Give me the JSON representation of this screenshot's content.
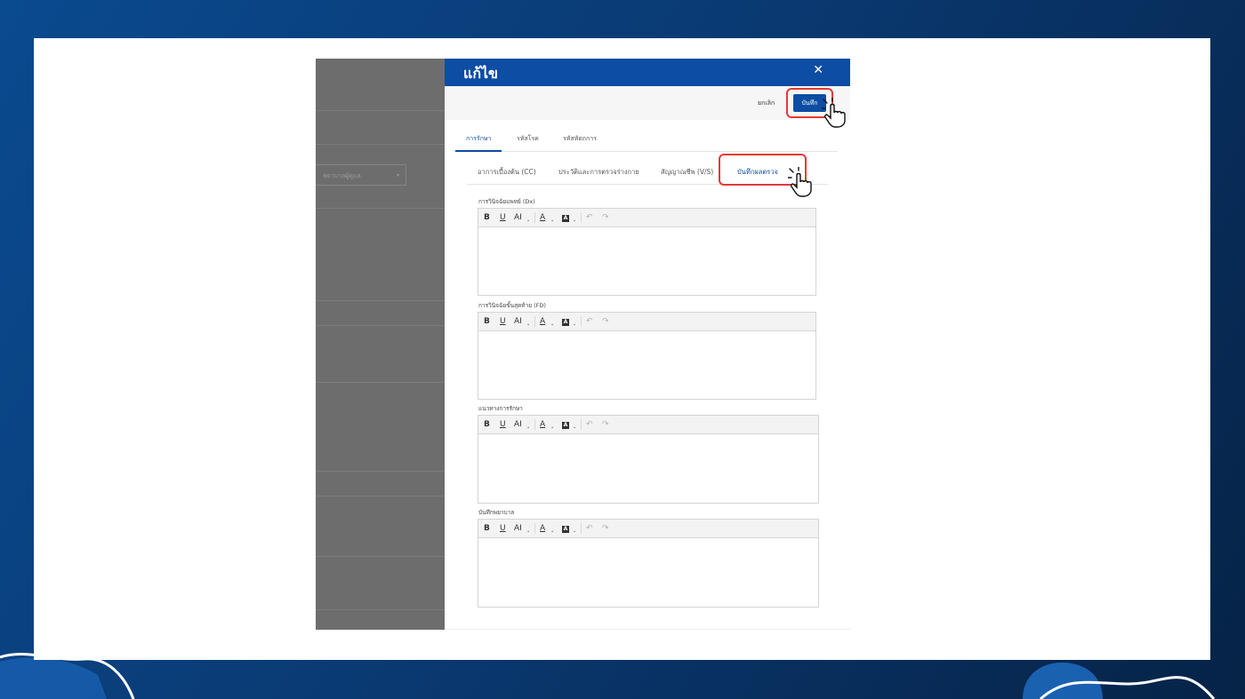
{
  "drawer": {
    "title": "แก้ไข",
    "close_glyph": "✕",
    "cancel_label": "ยกเลิก",
    "save_label": "บันทึก"
  },
  "background_form": {
    "select_placeholder": "พยาบาลผู้ดูแล",
    "select_caret": "▾"
  },
  "tabs_primary": [
    {
      "label": "การรักษา",
      "active": true
    },
    {
      "label": "รหัสโรค",
      "active": false
    },
    {
      "label": "รหัสหัตถการ",
      "active": false
    }
  ],
  "tabs_secondary": [
    {
      "label": "อาการเบื้องต้น (CC)",
      "active": false
    },
    {
      "label": "ประวัติและการตรวจร่างกาย",
      "active": false
    },
    {
      "label": "สัญญาณชีพ (V/S)",
      "active": false
    },
    {
      "label": "บันทึกผลตรวจ",
      "active": true
    }
  ],
  "toolbar": {
    "bold": "B",
    "underline": "U",
    "font_size": "AI",
    "font_color": "A",
    "bg_color": "A",
    "caret": "⌄",
    "undo": "↶",
    "redo": "↷"
  },
  "fields": [
    {
      "label": "การวินิจฉัยแพทย์ (Dx)"
    },
    {
      "label": "การวินิจฉัยขั้นสุดท้าย (FD)"
    },
    {
      "label": "แนวทางการรักษา"
    },
    {
      "label": "บันทึกพยาบาล"
    }
  ],
  "colors": {
    "accent": "#0d4da3",
    "highlight": "#e53935",
    "overlay": "#6d6d6d"
  },
  "icons": {
    "close": "close-icon",
    "pointer": "hand-pointer-icon",
    "undo": "undo-icon",
    "redo": "redo-icon"
  }
}
